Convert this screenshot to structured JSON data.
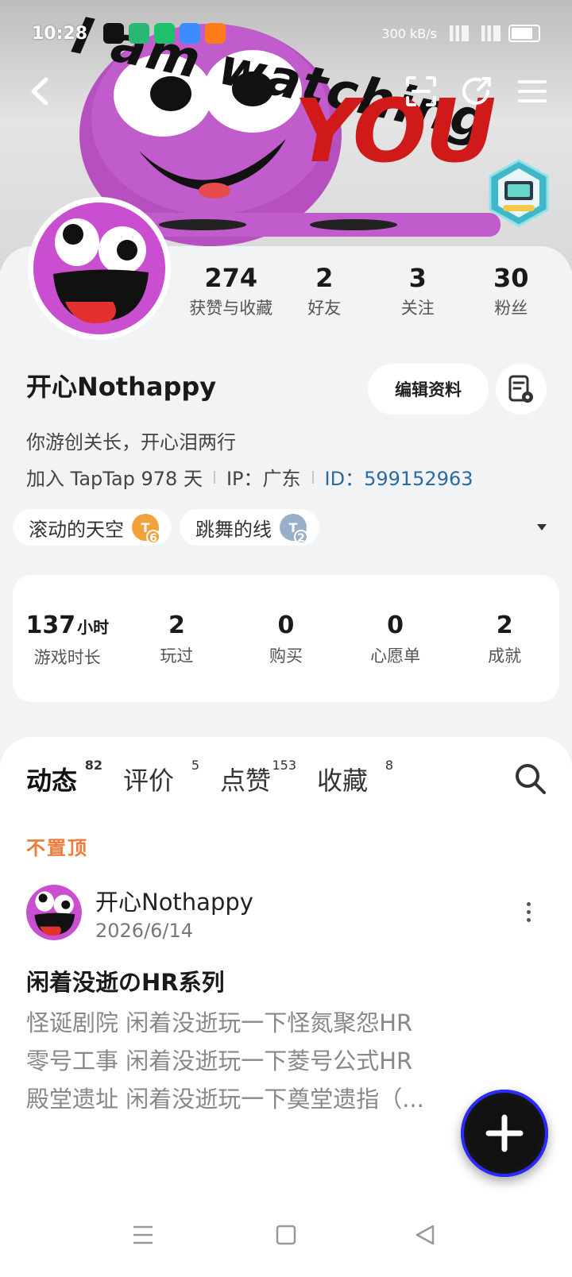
{
  "status_bar": {
    "time": "10:28",
    "net_speed": "300 kB/s"
  },
  "banner": {
    "line1": "I am watching",
    "line2": "YOU"
  },
  "profile": {
    "stats": [
      {
        "num": "274",
        "label": "获赞与收藏"
      },
      {
        "num": "2",
        "label": "好友"
      },
      {
        "num": "3",
        "label": "关注"
      },
      {
        "num": "30",
        "label": "粉丝"
      }
    ],
    "username": "开心Nothappy",
    "edit_label": "编辑资料",
    "bio": "你游创关长，开心泪两行",
    "join": "加入 TapTap 978 天",
    "ip": "IP：广东",
    "id": "ID：599152963",
    "tags": [
      {
        "label": "滚动的天空",
        "level": "6",
        "color": "#f2a23a"
      },
      {
        "label": "跳舞的线",
        "level": "2",
        "color": "#98aec9"
      }
    ]
  },
  "game_stats": [
    {
      "num": "137",
      "unit": "小时",
      "label": "游戏时长"
    },
    {
      "num": "2",
      "label": "玩过"
    },
    {
      "num": "0",
      "label": "购买"
    },
    {
      "num": "0",
      "label": "心愿单"
    },
    {
      "num": "2",
      "label": "成就"
    }
  ],
  "feed": {
    "tabs": [
      {
        "label": "动态",
        "count": "82"
      },
      {
        "label": "评价",
        "count": "5"
      },
      {
        "label": "点赞",
        "count": "153"
      },
      {
        "label": "收藏",
        "count": "8"
      }
    ],
    "pin_label": "不置顶",
    "post": {
      "author": "开心Nothappy",
      "date": "2026/6/14",
      "title": "闲着没逝のHR系列",
      "lines": [
        "怪诞剧院 闲着没逝玩一下怪氮聚怨HR",
        "零号工事 闲着没逝玩一下菱号公式HR",
        "殿堂遗址 闲着没逝玩一下奠堂遗指（..."
      ]
    }
  },
  "colors": {
    "accent": "#19c6b8",
    "id_link": "#2a6aa3",
    "pin": "#f07a3a"
  }
}
